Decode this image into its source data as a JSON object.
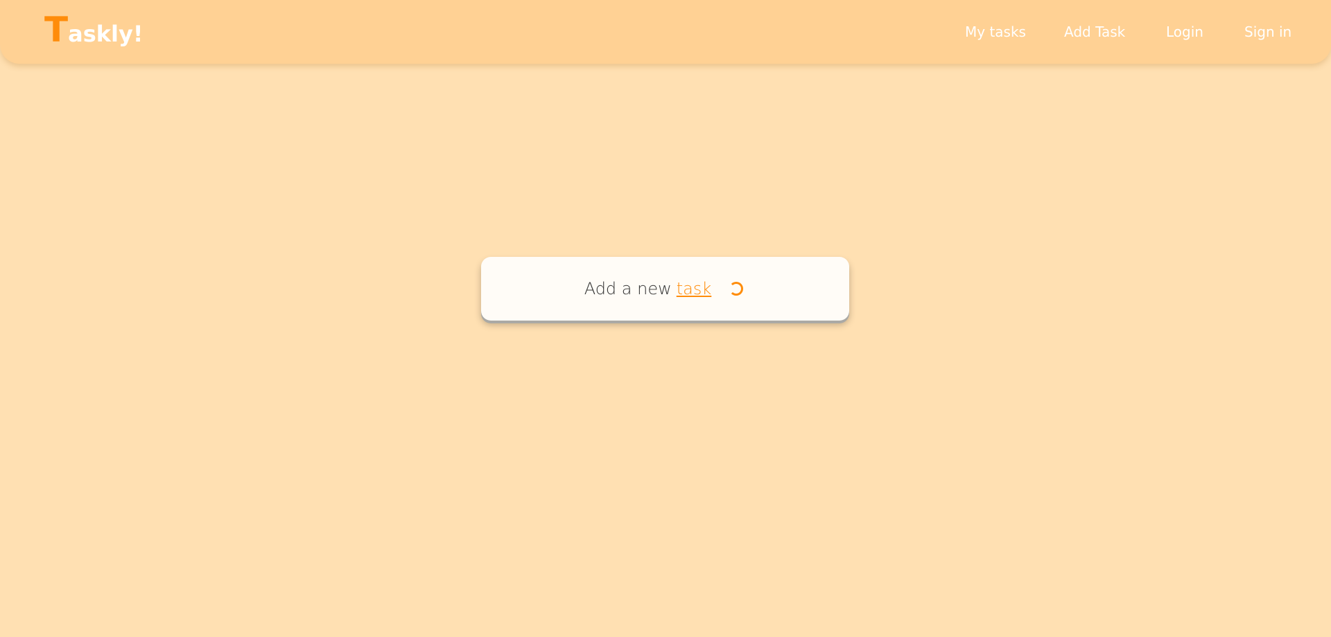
{
  "brand": {
    "initial": "T",
    "rest": "askly!"
  },
  "nav": {
    "items": [
      {
        "label": "My tasks"
      },
      {
        "label": "Add Task"
      },
      {
        "label": "Login"
      },
      {
        "label": "Sign in"
      }
    ]
  },
  "card": {
    "prefix": "Add a new",
    "link": "task",
    "status": "loading-spinner-icon"
  },
  "colors": {
    "background": "#ffe0b2",
    "navbar": "#ffd194",
    "accent": "#ff8c0a",
    "card": "#fffcf7"
  }
}
